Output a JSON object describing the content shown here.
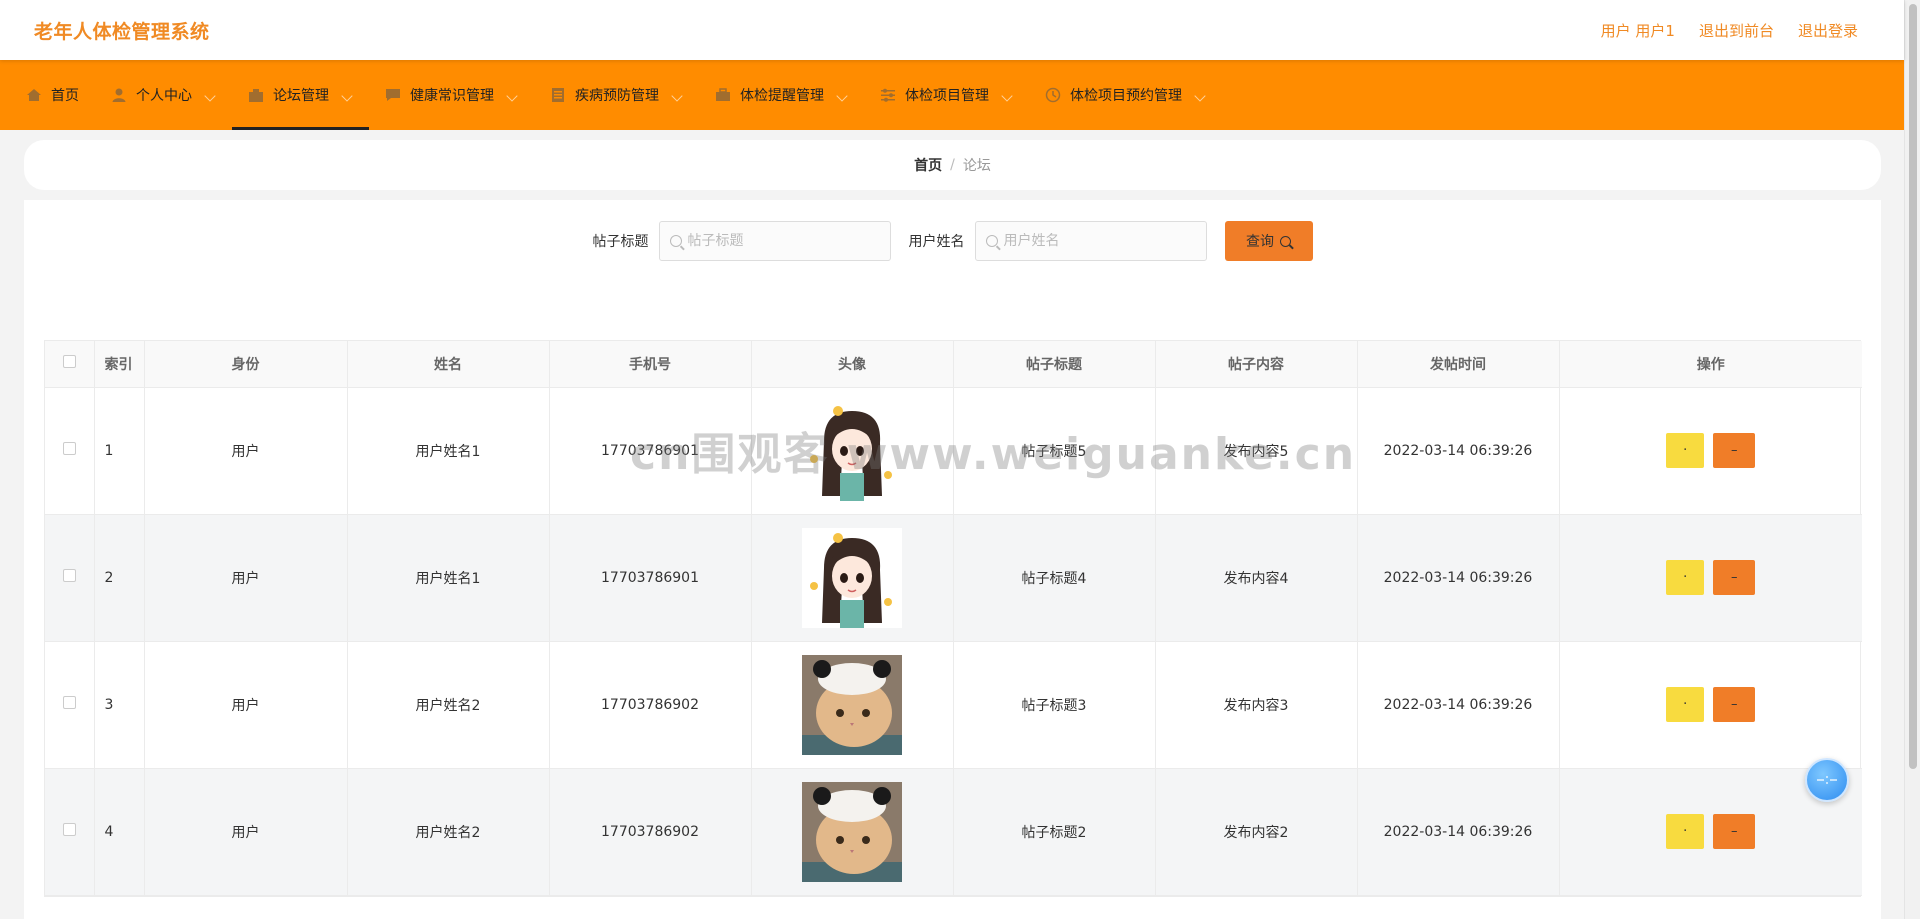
{
  "header": {
    "app_title": "老年人体检管理系统",
    "user_label": "用户 用户1",
    "to_front_label": "退出到前台",
    "logout_label": "退出登录"
  },
  "nav": {
    "items": [
      {
        "label": "首页",
        "icon": "home-icon"
      },
      {
        "label": "个人中心",
        "icon": "user-icon"
      },
      {
        "label": "论坛管理",
        "icon": "forum-icon"
      },
      {
        "label": "健康常识管理",
        "icon": "chat-icon"
      },
      {
        "label": "疾病预防管理",
        "icon": "document-icon"
      },
      {
        "label": "体检提醒管理",
        "icon": "briefcase-icon"
      },
      {
        "label": "体检项目管理",
        "icon": "sliders-icon"
      },
      {
        "label": "体检项目预约管理",
        "icon": "clock-icon"
      }
    ]
  },
  "breadcrumb": {
    "home": "首页",
    "separator": "/",
    "current": "论坛"
  },
  "search": {
    "title_label": "帖子标题",
    "title_placeholder": "帖子标题",
    "name_label": "用户姓名",
    "name_placeholder": "用户姓名",
    "query_label": "查询"
  },
  "table": {
    "headers": [
      "索引",
      "身份",
      "姓名",
      "手机号",
      "头像",
      "帖子标题",
      "帖子内容",
      "发帖时间",
      "操作"
    ],
    "rows": [
      {
        "index": "1",
        "role": "用户",
        "name": "用户姓名1",
        "phone": "17703786901",
        "title": "帖子标题5",
        "content": "发布内容5",
        "time": "2022-03-14 06:39:26",
        "avatar": "girl"
      },
      {
        "index": "2",
        "role": "用户",
        "name": "用户姓名1",
        "phone": "17703786901",
        "title": "帖子标题4",
        "content": "发布内容4",
        "time": "2022-03-14 06:39:26",
        "avatar": "girl"
      },
      {
        "index": "3",
        "role": "用户",
        "name": "用户姓名2",
        "phone": "17703786902",
        "title": "帖子标题3",
        "content": "发布内容3",
        "time": "2022-03-14 06:39:26",
        "avatar": "cat"
      },
      {
        "index": "4",
        "role": "用户",
        "name": "用户姓名2",
        "phone": "17703786902",
        "title": "帖子标题2",
        "content": "发布内容2",
        "time": "2022-03-14 06:39:26",
        "avatar": "cat"
      }
    ],
    "detail_label": "·",
    "delete_label": "–"
  },
  "watermark": "cn围观客 www.weiguanke.cn",
  "colors": {
    "accent": "#ff8c00",
    "title": "#f08a24",
    "query_button": "#f07d28",
    "detail_button": "#f8db3f",
    "delete_button": "#f07d28"
  }
}
